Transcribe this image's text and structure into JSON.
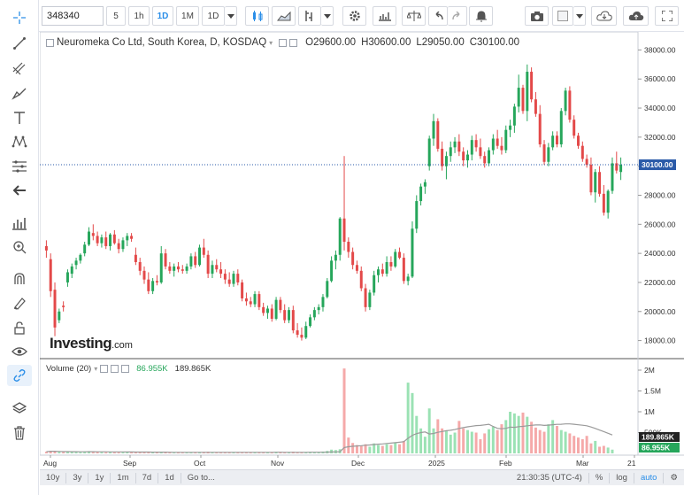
{
  "toolbar": {
    "symbol": "348340",
    "intervals": [
      "5",
      "1h",
      "1D",
      "1M",
      "1D"
    ],
    "active_interval": "1D",
    "colors": {
      "accent": "#2a8ee8"
    }
  },
  "legend": {
    "title": "Neuromeka Co Ltd, South Korea, D, KOSDAQ",
    "open": "O29600.00",
    "high": "H30600.00",
    "low": "L29050.00",
    "close": "C30100.00"
  },
  "volume_legend": {
    "label": "Volume (20)",
    "value1": "86.955K",
    "value2": "189.865K"
  },
  "logo": {
    "brand": "Investing",
    "domain": ".com"
  },
  "price_axis": {
    "ticks": [
      "38000.00",
      "36000.00",
      "34000.00",
      "32000.00",
      "30000.00",
      "28000.00",
      "26000.00",
      "24000.00",
      "22000.00",
      "20000.00",
      "18000.00"
    ],
    "current": "30100.00",
    "current_value": 30100
  },
  "volume_axis": {
    "ticks": [
      "2M",
      "1.5M",
      "1M",
      "500K"
    ],
    "badge_ma": "189.865K",
    "badge_vol": "86.955K"
  },
  "time_axis": [
    "Aug",
    "Sep",
    "Oct",
    "Nov",
    "Dec",
    "2025",
    "Feb",
    "Mar",
    "21"
  ],
  "bottom": {
    "ranges": [
      "10y",
      "3y",
      "1y",
      "1m",
      "7d",
      "1d",
      "Go to..."
    ],
    "time": "21:30:35 (UTC-4)",
    "pct": "%",
    "log": "log",
    "auto": "auto"
  },
  "chart_data": {
    "type": "candlestick",
    "up_color": "#26a65b",
    "down_color": "#e34949",
    "ylim": [
      17000,
      39000
    ],
    "candles": [
      [
        24500,
        24900,
        23700,
        24200
      ],
      [
        23600,
        24000,
        21000,
        21400
      ],
      [
        21500,
        22000,
        18300,
        18900
      ],
      [
        19400,
        20200,
        19200,
        20000
      ],
      [
        20400,
        20700,
        20000,
        20300
      ],
      [
        22000,
        22900,
        21700,
        22700
      ],
      [
        22600,
        23300,
        22300,
        23100
      ],
      [
        23200,
        23700,
        22900,
        23500
      ],
      [
        23500,
        24000,
        23300,
        23900
      ],
      [
        24000,
        24800,
        23800,
        24600
      ],
      [
        24600,
        25800,
        24500,
        25500
      ],
      [
        25400,
        26000,
        24900,
        25200
      ],
      [
        25200,
        25500,
        24500,
        24700
      ],
      [
        24700,
        25300,
        24400,
        25100
      ],
      [
        25100,
        25500,
        24300,
        24500
      ],
      [
        24500,
        25400,
        24200,
        25300
      ],
      [
        25300,
        25600,
        24600,
        24700
      ],
      [
        24700,
        25000,
        24000,
        24300
      ],
      [
        24300,
        25100,
        24100,
        24900
      ],
      [
        24900,
        25400,
        24500,
        25200
      ],
      [
        25200,
        25400,
        24800,
        25000
      ],
      [
        23900,
        24400,
        23200,
        23400
      ],
      [
        23400,
        23700,
        22500,
        22800
      ],
      [
        22800,
        23100,
        21900,
        22200
      ],
      [
        22200,
        22700,
        21200,
        21400
      ],
      [
        21400,
        22300,
        21200,
        22100
      ],
      [
        22100,
        22500,
        21800,
        22000
      ],
      [
        22000,
        24500,
        21900,
        24000
      ],
      [
        24000,
        24300,
        22900,
        23100
      ],
      [
        23100,
        23400,
        22600,
        22800
      ],
      [
        22800,
        23300,
        22400,
        23100
      ],
      [
        23100,
        23400,
        22700,
        22900
      ],
      [
        22900,
        23200,
        22600,
        22800
      ],
      [
        22800,
        23300,
        22600,
        23100
      ],
      [
        23100,
        24000,
        22900,
        23800
      ],
      [
        23800,
        24100,
        23000,
        23200
      ],
      [
        23200,
        24600,
        23100,
        24400
      ],
      [
        24400,
        25000,
        23700,
        23900
      ],
      [
        23900,
        24200,
        22300,
        22600
      ],
      [
        22600,
        23500,
        22300,
        23200
      ],
      [
        23200,
        23600,
        22700,
        22900
      ],
      [
        22900,
        23400,
        22300,
        22600
      ],
      [
        22600,
        22900,
        21900,
        22200
      ],
      [
        22200,
        22700,
        21700,
        21900
      ],
      [
        21900,
        22800,
        21700,
        22600
      ],
      [
        22600,
        22900,
        21800,
        22000
      ],
      [
        22000,
        22200,
        20700,
        20900
      ],
      [
        20900,
        21300,
        20400,
        20700
      ],
      [
        20700,
        21000,
        20300,
        20500
      ],
      [
        20500,
        21400,
        20300,
        21200
      ],
      [
        21200,
        21400,
        20100,
        20300
      ],
      [
        20300,
        20600,
        19700,
        19900
      ],
      [
        19900,
        20400,
        19500,
        20200
      ],
      [
        20200,
        20500,
        19300,
        19500
      ],
      [
        19500,
        21000,
        19400,
        20800
      ],
      [
        20800,
        21000,
        19900,
        20100
      ],
      [
        20100,
        20500,
        19200,
        19400
      ],
      [
        19400,
        20300,
        19200,
        20100
      ],
      [
        20100,
        20400,
        18500,
        18700
      ],
      [
        18700,
        19200,
        18200,
        18400
      ],
      [
        18400,
        18900,
        18000,
        18200
      ],
      [
        18200,
        19300,
        18100,
        19000
      ],
      [
        19000,
        19800,
        18900,
        19600
      ],
      [
        19600,
        20300,
        19400,
        20100
      ],
      [
        20100,
        20500,
        19800,
        20300
      ],
      [
        20300,
        21200,
        20000,
        21000
      ],
      [
        21000,
        22300,
        20900,
        22100
      ],
      [
        22100,
        23800,
        22000,
        23500
      ],
      [
        23500,
        24200,
        22900,
        23900
      ],
      [
        23900,
        26500,
        23500,
        26400
      ],
      [
        26400,
        30700,
        24200,
        24800
      ],
      [
        24800,
        25100,
        23700,
        24100
      ],
      [
        24100,
        24400,
        22900,
        23200
      ],
      [
        23200,
        23500,
        22600,
        22800
      ],
      [
        22800,
        23100,
        21400,
        21600
      ],
      [
        21600,
        21900,
        20000,
        20300
      ],
      [
        20300,
        21500,
        20100,
        21300
      ],
      [
        21300,
        22800,
        21100,
        22500
      ],
      [
        22500,
        23100,
        22000,
        22900
      ],
      [
        22900,
        23300,
        22400,
        22600
      ],
      [
        22600,
        23800,
        22400,
        23400
      ],
      [
        23400,
        23800,
        22800,
        23100
      ],
      [
        23100,
        24300,
        23000,
        24100
      ],
      [
        24100,
        24400,
        23600,
        23700
      ],
      [
        23700,
        24000,
        21900,
        22100
      ],
      [
        22100,
        22600,
        21800,
        22400
      ],
      [
        22400,
        26200,
        22300,
        25700
      ],
      [
        25700,
        28000,
        25400,
        27600
      ],
      [
        27600,
        28800,
        27300,
        28600
      ],
      [
        28600,
        29100,
        28100,
        28900
      ],
      [
        30000,
        32100,
        29700,
        31900
      ],
      [
        31900,
        33600,
        31400,
        33100
      ],
      [
        33100,
        33300,
        31000,
        31200
      ],
      [
        31200,
        31700,
        29700,
        30000
      ],
      [
        30000,
        31000,
        29100,
        30700
      ],
      [
        30700,
        31700,
        30300,
        31300
      ],
      [
        31300,
        32000,
        30900,
        31700
      ],
      [
        31700,
        32200,
        30700,
        31000
      ],
      [
        31000,
        31300,
        30000,
        30400
      ],
      [
        30400,
        31100,
        29900,
        30800
      ],
      [
        30800,
        32100,
        30400,
        31800
      ],
      [
        31800,
        32200,
        31000,
        31300
      ],
      [
        31300,
        31900,
        30500,
        30700
      ],
      [
        30700,
        31000,
        29900,
        30200
      ],
      [
        30200,
        31300,
        30000,
        31100
      ],
      [
        31100,
        32200,
        30800,
        31900
      ],
      [
        31900,
        32500,
        31200,
        31400
      ],
      [
        31400,
        32000,
        30800,
        31100
      ],
      [
        31100,
        32800,
        30900,
        32500
      ],
      [
        32500,
        33200,
        32000,
        32800
      ],
      [
        32800,
        34300,
        32300,
        34100
      ],
      [
        34100,
        36300,
        33700,
        35400
      ],
      [
        35400,
        35600,
        33600,
        33800
      ],
      [
        33800,
        37000,
        33100,
        36500
      ],
      [
        36500,
        36800,
        34400,
        34600
      ],
      [
        34600,
        35100,
        33400,
        33600
      ],
      [
        33600,
        34200,
        31300,
        31500
      ],
      [
        31500,
        31800,
        30100,
        30300
      ],
      [
        30300,
        31600,
        30000,
        31300
      ],
      [
        31300,
        32400,
        31100,
        32100
      ],
      [
        32100,
        32400,
        31300,
        31500
      ],
      [
        31500,
        34000,
        31300,
        33800
      ],
      [
        33800,
        35400,
        33500,
        35200
      ],
      [
        35200,
        35500,
        33000,
        33200
      ],
      [
        33200,
        33500,
        31900,
        32100
      ],
      [
        32100,
        32300,
        31200,
        31400
      ],
      [
        31400,
        31700,
        30300,
        30500
      ],
      [
        30500,
        30800,
        29900,
        30100
      ],
      [
        30100,
        30600,
        28000,
        28200
      ],
      [
        28200,
        29800,
        27500,
        29600
      ],
      [
        29600,
        30000,
        27900,
        28100
      ],
      [
        28100,
        28700,
        26600,
        26800
      ],
      [
        26800,
        28400,
        26400,
        28300
      ],
      [
        28300,
        30600,
        28100,
        30200
      ],
      [
        30200,
        31000,
        29500,
        29700
      ],
      [
        29600,
        30600,
        29050,
        30100
      ]
    ],
    "volumes": [
      40,
      60,
      50,
      35,
      30,
      40,
      35,
      30,
      28,
      45,
      55,
      30,
      32,
      28,
      25,
      30,
      26,
      24,
      28,
      30,
      26,
      28,
      24,
      30,
      26,
      22,
      20,
      35,
      26,
      22,
      18,
      20,
      18,
      22,
      30,
      25,
      34,
      35,
      40,
      30,
      25,
      24,
      22,
      20,
      25,
      24,
      30,
      22,
      20,
      25,
      24,
      22,
      26,
      24,
      35,
      25,
      30,
      26,
      40,
      28,
      26,
      30,
      34,
      30,
      28,
      45,
      60,
      90,
      80,
      100,
      2040,
      380,
      250,
      200,
      180,
      220,
      160,
      240,
      200,
      180,
      220,
      200,
      260,
      220,
      300,
      1700,
      1450,
      900,
      600,
      400,
      1080,
      600,
      820,
      600,
      540,
      450,
      500,
      780,
      600,
      560,
      520,
      500,
      340,
      480,
      580,
      640,
      560,
      700,
      800,
      1000,
      960,
      900,
      980,
      880,
      760,
      620,
      560,
      520,
      700,
      800,
      660,
      560,
      520,
      480,
      420,
      380,
      340,
      420,
      240,
      300,
      160,
      180,
      140,
      90
    ]
  }
}
